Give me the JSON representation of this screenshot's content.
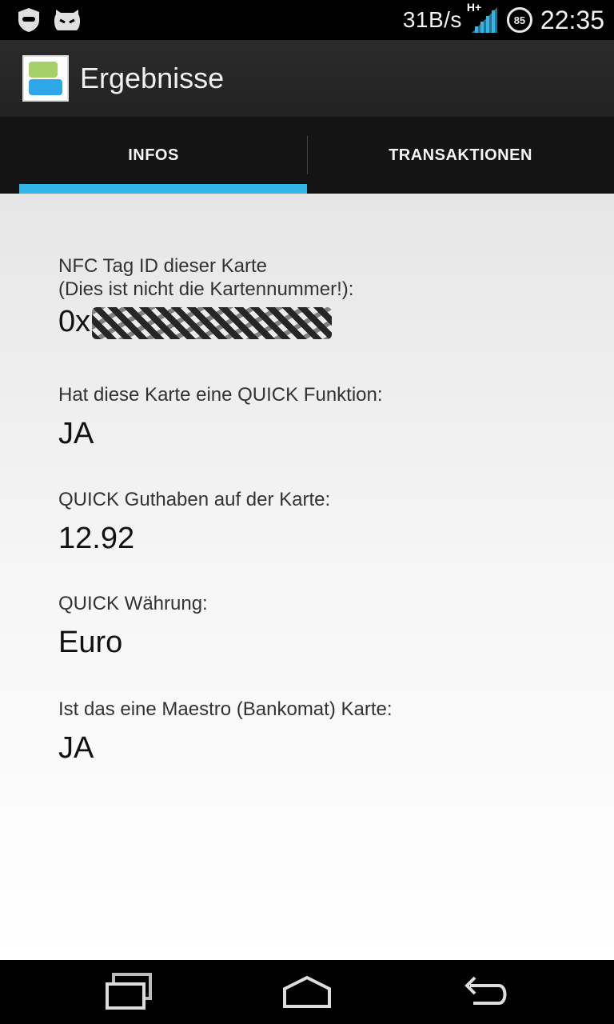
{
  "status_bar": {
    "net_speed": "31B/s",
    "network_type": "H+",
    "battery_level": "85",
    "time": "22:35",
    "left_icons": [
      "privacy-guard-icon",
      "cyanogenmod-icon"
    ]
  },
  "action_bar": {
    "title": "Ergebnisse",
    "icon": "app-logo-icon"
  },
  "tabs": [
    {
      "label": "INFOS",
      "selected": true
    },
    {
      "label": "TRANSAKTIONEN",
      "selected": false
    }
  ],
  "fields": [
    {
      "label": "NFC Tag ID dieser Karte\n(Dies ist nicht die Kartennummer!):",
      "value": "0x"
    },
    {
      "label": "Hat diese Karte eine QUICK Funktion:",
      "value": "JA"
    },
    {
      "label": "QUICK Guthaben auf der Karte:",
      "value": "12.92"
    },
    {
      "label": "QUICK Währung:",
      "value": "Euro"
    },
    {
      "label": "Ist das eine Maestro (Bankomat) Karte:",
      "value": "JA"
    }
  ],
  "nav_bar": [
    "recent-apps-icon",
    "home-icon",
    "back-icon"
  ],
  "colors": {
    "accent": "#33b5e5",
    "action_bar": "#262626",
    "tab_bar": "#141414"
  }
}
